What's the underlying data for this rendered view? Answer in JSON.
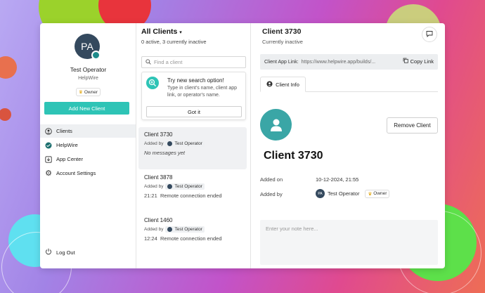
{
  "sidebar": {
    "avatar_initials": "PA",
    "user_name": "Test Operator",
    "org_name": "HelpWire",
    "role_badge": "Owner",
    "add_button": "Add New Client",
    "nav": [
      {
        "label": "Clients",
        "icon": "user-circle-icon"
      },
      {
        "label": "HelpWire",
        "icon": "helpwire-logo-icon"
      },
      {
        "label": "App Center",
        "icon": "download-icon"
      },
      {
        "label": "Account Settings",
        "icon": "gear-icon"
      }
    ],
    "logout": "Log Out"
  },
  "clients_panel": {
    "title": "All Clients",
    "subtitle": "0 active, 3 currently inactive",
    "search_placeholder": "Find a client",
    "tip": {
      "title": "Try new search option!",
      "text": "Type in client's name, client app link, or operator's name.",
      "button": "Got it"
    },
    "added_by_label": "Added by",
    "items": [
      {
        "name": "Client 3730",
        "operator": "Test Operator",
        "status": "No messages yet"
      },
      {
        "name": "Client 3878",
        "operator": "Test Operator",
        "time": "21:21",
        "status": "Remote connection ended"
      },
      {
        "name": "Client 1460",
        "operator": "Test Operator",
        "time": "12:24",
        "status": "Remote connection ended"
      }
    ]
  },
  "detail": {
    "title": "Client 3730",
    "subtitle": "Currently inactive",
    "link_label": "Client App Link:",
    "link_url": "https://www.helpwire.app/builds/...",
    "copy_label": "Copy Link",
    "tab_label": "Client Info",
    "remove_button": "Remove Client",
    "client_name": "Client 3730",
    "added_on_label": "Added on",
    "added_on_value": "10-12-2024, 21:55",
    "added_by_label": "Added by",
    "added_by_initials": "PA",
    "added_by_value": "Test Operator",
    "added_by_role": "Owner",
    "note_placeholder": "Enter your note here..."
  },
  "colors": {
    "accent": "#2ec4b6",
    "avatar": "#34495e"
  }
}
